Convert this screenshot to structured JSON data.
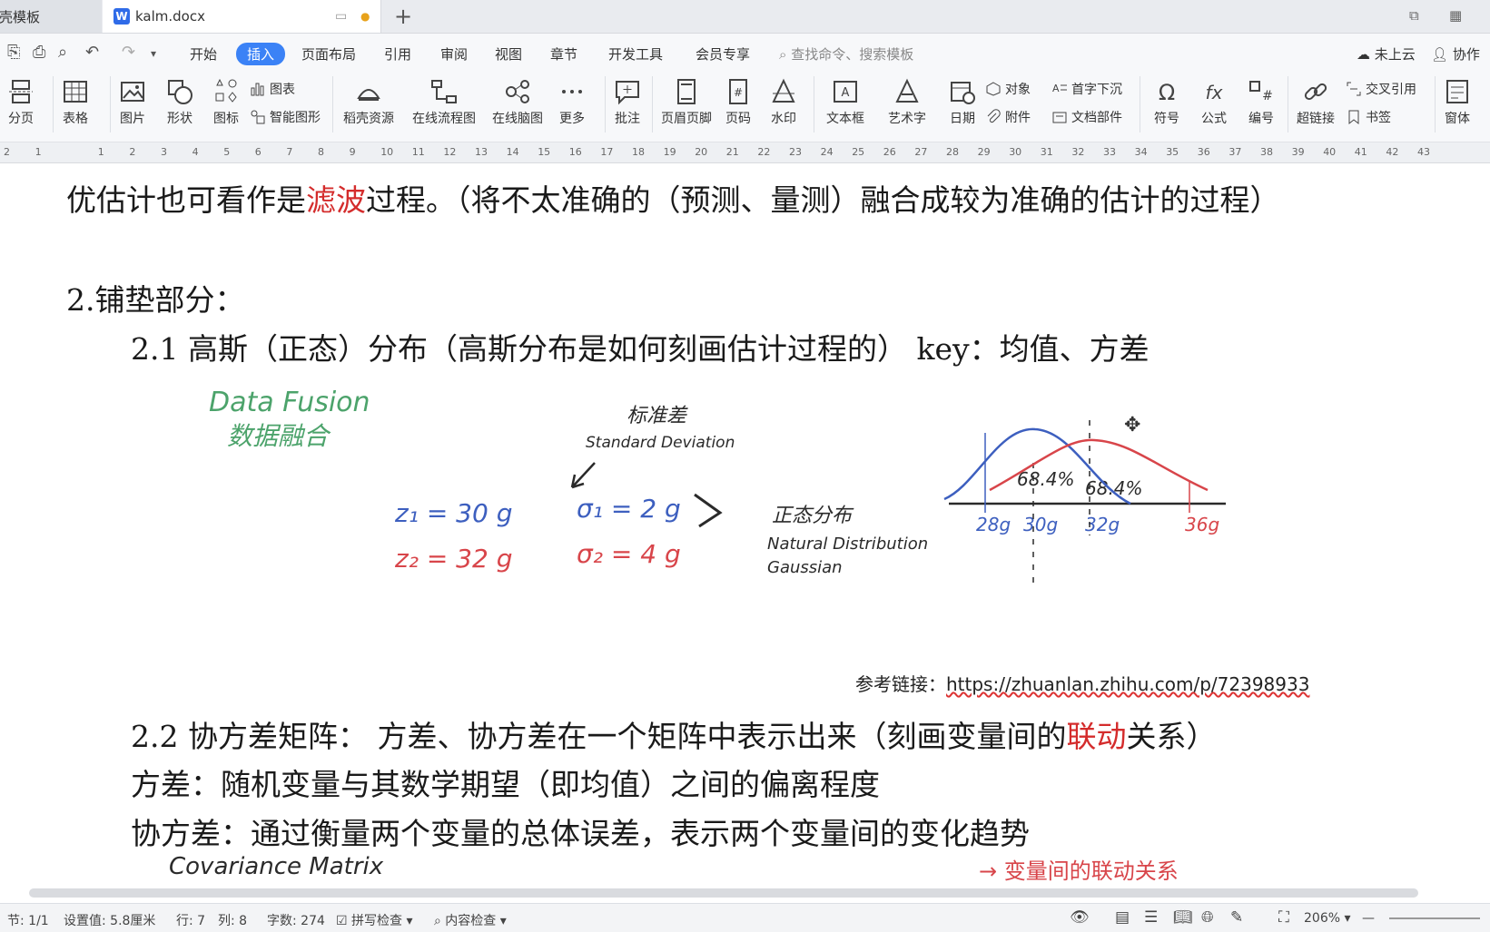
{
  "tabs": {
    "tab1_label": "稻壳模板",
    "tab2_label": "kalm.docx"
  },
  "menubar": {
    "items": [
      "开始",
      "插入",
      "页面布局",
      "引用",
      "审阅",
      "视图",
      "章节",
      "开发工具",
      "会员专享"
    ],
    "active": "插入",
    "search_placeholder": "查找命令、搜索模板",
    "cloud": "未上云",
    "collab": "协作"
  },
  "ribbon": {
    "page_break": "分页",
    "table": "表格",
    "picture": "图片",
    "shape": "形状",
    "icon": "图标",
    "chart": "图表",
    "smart_art": "智能图形",
    "docer_res": "稻壳资源",
    "online_flow": "在线流程图",
    "online_mind": "在线脑图",
    "more": "更多",
    "comment": "批注",
    "header_footer": "页眉页脚",
    "page_num": "页码",
    "watermark": "水印",
    "textbox": "文本框",
    "wordart": "艺术字",
    "date": "日期",
    "object": "对象",
    "attachment": "附件",
    "dropcap": "首字下沉",
    "doc_parts": "文档部件",
    "symbol": "符号",
    "formula": "公式",
    "numbering": "编号",
    "hyperlink": "超链接",
    "cross_ref": "交叉引用",
    "bookmark": "书签",
    "window": "窗体"
  },
  "ruler": {
    "ticks": [
      "2",
      "1",
      "",
      "1",
      "2",
      "3",
      "4",
      "5",
      "6",
      "7",
      "8",
      "9",
      "10",
      "11",
      "12",
      "13",
      "14",
      "15",
      "16",
      "17",
      "18",
      "19",
      "20",
      "21",
      "22",
      "23",
      "24",
      "25",
      "26",
      "27",
      "28",
      "29",
      "30",
      "31",
      "32",
      "33",
      "34",
      "35",
      "36",
      "37",
      "38",
      "39",
      "40",
      "41",
      "42",
      "43"
    ]
  },
  "document": {
    "line1_a": "优估计也可看作是",
    "line1_red": "滤波",
    "line1_b": "过程。（将不太准确的（预测、量测）融合成较为准确的估计的过程）",
    "heading2": "2.铺垫部分：",
    "h21": "2.1 高斯（正态）分布（高斯分布是如何刻画估计过程的）  key：均值、方差",
    "ref_label": "参考链接：",
    "ref_url": "https://zhuanlan.zhihu.com/p/72398933",
    "h22_a": "2.2 协方差矩阵：  方差、协方差在一个矩阵中表示出来（刻画变量间的",
    "h22_red": "联动",
    "h22_b": "关系）",
    "variance": "方差：随机变量与其数学期望（即均值）之间的偏离程度",
    "covariance": "协方差：通过衡量两个变量的总体误差，表示两个变量间的变化趋势"
  },
  "figure": {
    "fusion_en": "Data Fusion",
    "fusion_cn": "数据融合",
    "std_cn": "标准差",
    "std_en": "Standard Deviation",
    "z1": "z₁ = 30 g",
    "z2": "z₂ = 32 g",
    "s1": "σ₁ = 2 g",
    "s2": "σ₂ = 4 g",
    "normal_cn": "正态分布",
    "normal_en": "Natural Distribution",
    "gaussian": "Gaussian",
    "pct1": "68.4%",
    "pct2": "68.4%",
    "t1": "28g",
    "t2": "30g",
    "t3": "32g",
    "t4": "36g",
    "cov_en": "Covariance   Matrix",
    "bottom_red": "→ 变量间的联动关系",
    "colors": {
      "blue": "#3d5fbf",
      "red": "#d8454a",
      "green": "#4ca36b",
      "ink": "#2a2a2a"
    }
  },
  "status": {
    "section": "节: 1/1",
    "setting": "设置值: 5.8厘米",
    "row": "行: 7",
    "col": "列: 8",
    "words": "字数: 274",
    "spell": "拼写检查",
    "content_check": "内容检查",
    "zoom": "206%"
  }
}
